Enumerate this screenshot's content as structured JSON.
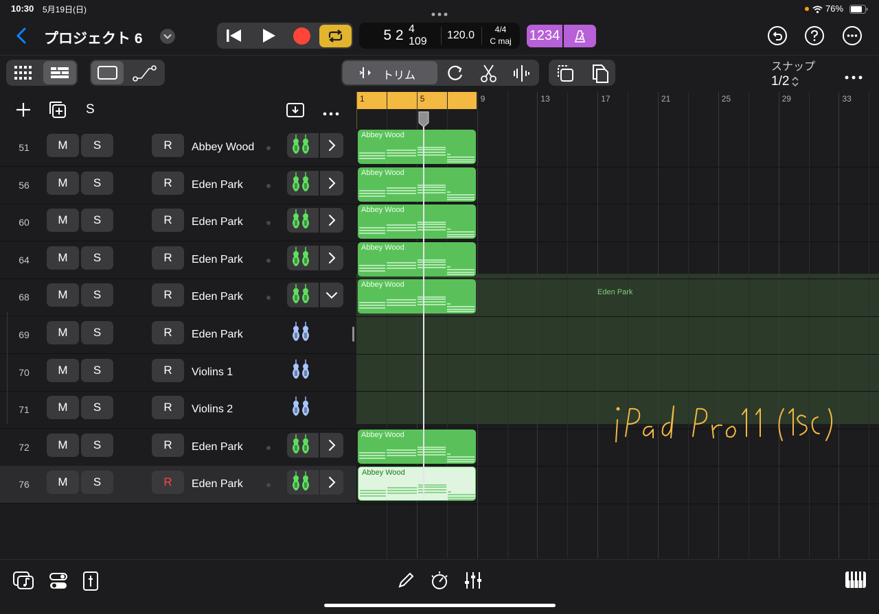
{
  "status": {
    "time": "10:30",
    "date": "5月19日(日)",
    "battery": "76%"
  },
  "header": {
    "project_title": "プロジェクト 6",
    "lcd": {
      "bar_beat": "5 2",
      "sub": "4 109",
      "tempo": "120.0",
      "signature": "4/4",
      "key": "C maj"
    },
    "count_in": "1234"
  },
  "toolbar": {
    "trim_label": "トリム",
    "snap_label": "スナップ",
    "snap_value": "1/2"
  },
  "track_header": {
    "solo_label": "S"
  },
  "ruler": {
    "marks": [
      "1",
      "5",
      "9",
      "13",
      "17",
      "21",
      "25",
      "29",
      "33"
    ]
  },
  "tracks": [
    {
      "number": "51",
      "mute": "M",
      "solo": "S",
      "record": "R",
      "name": "Abbey Wood",
      "region": "Abbey Wood"
    },
    {
      "number": "56",
      "mute": "M",
      "solo": "S",
      "record": "R",
      "name": "Eden Park",
      "region": "Abbey Wood"
    },
    {
      "number": "60",
      "mute": "M",
      "solo": "S",
      "record": "R",
      "name": "Eden Park",
      "region": "Abbey Wood"
    },
    {
      "number": "64",
      "mute": "M",
      "solo": "S",
      "record": "R",
      "name": "Eden Park",
      "region": "Abbey Wood"
    },
    {
      "number": "68",
      "mute": "M",
      "solo": "S",
      "record": "R",
      "name": "Eden Park",
      "region": "Abbey Wood"
    },
    {
      "number": "69",
      "mute": "M",
      "solo": "S",
      "record": "R",
      "name": "Eden Park"
    },
    {
      "number": "70",
      "mute": "M",
      "solo": "S",
      "record": "R",
      "name": "Violins 1"
    },
    {
      "number": "71",
      "mute": "M",
      "solo": "S",
      "record": "R",
      "name": "Violins 2"
    },
    {
      "number": "72",
      "mute": "M",
      "solo": "S",
      "record": "R",
      "name": "Eden Park",
      "region": "Abbey Wood"
    },
    {
      "number": "76",
      "mute": "M",
      "solo": "S",
      "record": "R",
      "name": "Eden Park",
      "region": "Abbey Wood"
    }
  ],
  "folder_label": "Eden Park",
  "annotation": "iPad Pro 11 (1st)",
  "colors": {
    "accent": "#0a84ff",
    "record": "#ff453a",
    "cycle": "#e3b42d",
    "region": "#5ac15a",
    "folder": "#2c3a2a",
    "count_in": "#b760d8",
    "ruler_cycle": "#f3b941"
  }
}
